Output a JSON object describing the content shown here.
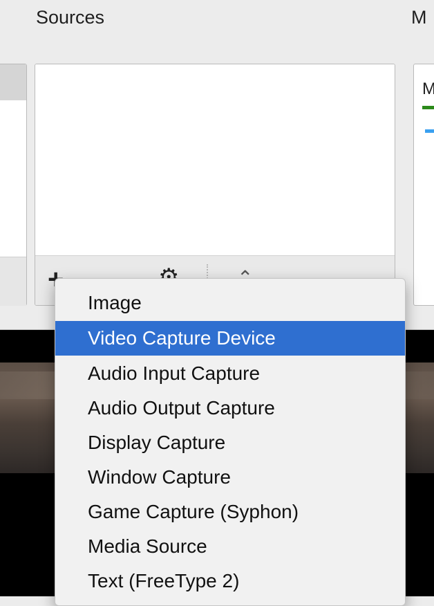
{
  "docks": {
    "sources_title": "Sources",
    "mixer_title": "M",
    "mixer_label": "M"
  },
  "sources_toolbar": {
    "add_label": "+",
    "settings_label": "⚙",
    "move_up_label": "⌃",
    "move_down_label": "⌄"
  },
  "menu": {
    "items": [
      {
        "label": "Image",
        "selected": false
      },
      {
        "label": "Video Capture Device",
        "selected": true
      },
      {
        "label": "Audio Input Capture",
        "selected": false
      },
      {
        "label": "Audio Output Capture",
        "selected": false
      },
      {
        "label": "Display Capture",
        "selected": false
      },
      {
        "label": "Window Capture",
        "selected": false
      },
      {
        "label": "Game Capture (Syphon)",
        "selected": false
      },
      {
        "label": "Media Source",
        "selected": false
      },
      {
        "label": "Text (FreeType 2)",
        "selected": false
      }
    ]
  },
  "colors": {
    "selection": "#2f6fd0",
    "mixer_green": "#2c8a1a",
    "mixer_blue": "#3aa0f0"
  }
}
